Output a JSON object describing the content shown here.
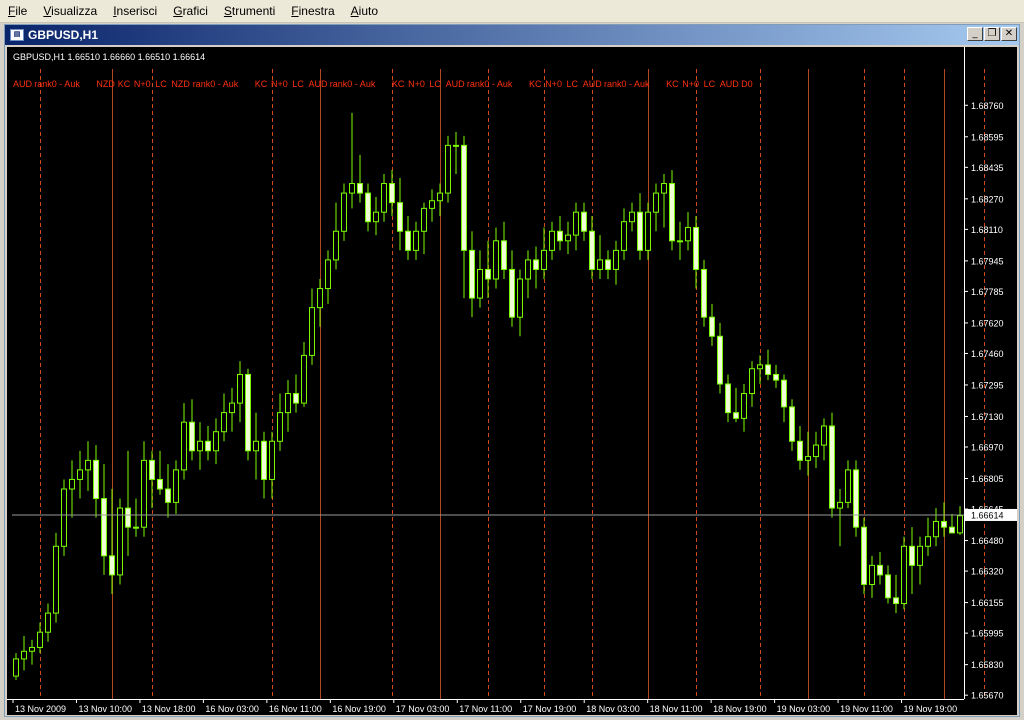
{
  "menu": [
    "File",
    "Visualizza",
    "Inserisci",
    "Grafici",
    "Strumenti",
    "Finestra",
    "Aiuto"
  ],
  "window": {
    "title": "GBPUSD,H1",
    "minimize_glyph": "_",
    "restore_glyph": "❐",
    "close_glyph": "✕"
  },
  "colors": {
    "background": "#000000",
    "bull_body": "#000000",
    "bear_body": "#f0ffd8",
    "candle_outline": "#7cfc00",
    "solid_line": "#b34820",
    "dashed_line": "#d04a20",
    "label_text": "#ff3010",
    "ticks_text": "#ffffff",
    "price_line": "#9a9a9a"
  },
  "chart_data": {
    "type": "candlestick",
    "header": "GBPUSD,H1  1.66510 1.66660 1.66510 1.66614",
    "current_price": 1.66614,
    "current_price_label": "1.66614",
    "ylim": [
      1.6565,
      1.6895
    ],
    "y_ticks": [
      "1.68760",
      "1.68595",
      "1.68435",
      "1.68270",
      "1.68110",
      "1.67945",
      "1.67785",
      "1.67620",
      "1.67460",
      "1.67295",
      "1.67130",
      "1.66970",
      "1.66805",
      "1.66645",
      "1.66480",
      "1.66320",
      "1.66155",
      "1.65995",
      "1.65830",
      "1.65670"
    ],
    "x_ticks": [
      "13 Nov 2009",
      "13 Nov 10:00",
      "13 Nov 18:00",
      "16 Nov 03:00",
      "16 Nov 11:00",
      "16 Nov 19:00",
      "17 Nov 03:00",
      "17 Nov 11:00",
      "17 Nov 19:00",
      "18 Nov 03:00",
      "18 Nov 11:00",
      "18 Nov 19:00",
      "19 Nov 03:00",
      "19 Nov 11:00",
      "19 Nov 19:00"
    ],
    "event_labels": [
      "AUD",
      "rank0 - Auk",
      "NZD",
      "KC",
      "N+0",
      "LC",
      "NZD",
      "rank0 - Auk",
      "KC",
      "N+0",
      "LC",
      "AUD",
      "rank0 - Auk",
      "KC",
      "N+0",
      "LC",
      "AUD",
      "rank0 - Auk",
      "KC",
      "N+0",
      "LC",
      "AUD",
      "rank0 - Auk",
      "KC",
      "N+0",
      "LC",
      "AUD",
      "D0"
    ],
    "event_bars": [
      3,
      12,
      17,
      32,
      38,
      47,
      53,
      59,
      66,
      72,
      79,
      85,
      93,
      99,
      106,
      111,
      116,
      121,
      126,
      132,
      139,
      146
    ],
    "event_styles": [
      "dash",
      "solid",
      "dash",
      "dash",
      "solid",
      "dash",
      "solid",
      "dash",
      "dash",
      "dash",
      "solid",
      "dash",
      "dash",
      "solid",
      "dash",
      "dash",
      "solid",
      "dash",
      "dash",
      "solid",
      "dash",
      "dash"
    ],
    "candles": [
      {
        "o": 1.6577,
        "h": 1.6589,
        "l": 1.6575,
        "c": 1.6586
      },
      {
        "o": 1.6586,
        "h": 1.6598,
        "l": 1.658,
        "c": 1.659
      },
      {
        "o": 1.659,
        "h": 1.6596,
        "l": 1.6583,
        "c": 1.6592
      },
      {
        "o": 1.6592,
        "h": 1.6605,
        "l": 1.6589,
        "c": 1.66
      },
      {
        "o": 1.66,
        "h": 1.6615,
        "l": 1.6595,
        "c": 1.661
      },
      {
        "o": 1.661,
        "h": 1.6652,
        "l": 1.6605,
        "c": 1.6645
      },
      {
        "o": 1.6645,
        "h": 1.668,
        "l": 1.664,
        "c": 1.6675
      },
      {
        "o": 1.6675,
        "h": 1.669,
        "l": 1.666,
        "c": 1.668
      },
      {
        "o": 1.668,
        "h": 1.6695,
        "l": 1.667,
        "c": 1.6685
      },
      {
        "o": 1.6685,
        "h": 1.67,
        "l": 1.6674,
        "c": 1.669
      },
      {
        "o": 1.669,
        "h": 1.6698,
        "l": 1.666,
        "c": 1.667
      },
      {
        "o": 1.667,
        "h": 1.6688,
        "l": 1.663,
        "c": 1.664
      },
      {
        "o": 1.664,
        "h": 1.6675,
        "l": 1.662,
        "c": 1.663
      },
      {
        "o": 1.663,
        "h": 1.667,
        "l": 1.6625,
        "c": 1.6665
      },
      {
        "o": 1.6665,
        "h": 1.6695,
        "l": 1.664,
        "c": 1.6655
      },
      {
        "o": 1.6655,
        "h": 1.667,
        "l": 1.665,
        "c": 1.6655
      },
      {
        "o": 1.6655,
        "h": 1.67,
        "l": 1.665,
        "c": 1.669
      },
      {
        "o": 1.669,
        "h": 1.6695,
        "l": 1.6665,
        "c": 1.668
      },
      {
        "o": 1.668,
        "h": 1.6695,
        "l": 1.6672,
        "c": 1.6675
      },
      {
        "o": 1.6675,
        "h": 1.6688,
        "l": 1.666,
        "c": 1.6668
      },
      {
        "o": 1.6668,
        "h": 1.669,
        "l": 1.6662,
        "c": 1.6685
      },
      {
        "o": 1.6685,
        "h": 1.672,
        "l": 1.668,
        "c": 1.671
      },
      {
        "o": 1.671,
        "h": 1.6722,
        "l": 1.669,
        "c": 1.6695
      },
      {
        "o": 1.6695,
        "h": 1.671,
        "l": 1.6685,
        "c": 1.67
      },
      {
        "o": 1.67,
        "h": 1.6708,
        "l": 1.669,
        "c": 1.6695
      },
      {
        "o": 1.6695,
        "h": 1.6712,
        "l": 1.6688,
        "c": 1.6705
      },
      {
        "o": 1.6705,
        "h": 1.6725,
        "l": 1.67,
        "c": 1.6715
      },
      {
        "o": 1.6715,
        "h": 1.6728,
        "l": 1.6705,
        "c": 1.672
      },
      {
        "o": 1.672,
        "h": 1.6742,
        "l": 1.671,
        "c": 1.6735
      },
      {
        "o": 1.6735,
        "h": 1.6738,
        "l": 1.669,
        "c": 1.6695
      },
      {
        "o": 1.6695,
        "h": 1.6715,
        "l": 1.668,
        "c": 1.67
      },
      {
        "o": 1.67,
        "h": 1.6705,
        "l": 1.667,
        "c": 1.668
      },
      {
        "o": 1.668,
        "h": 1.6705,
        "l": 1.667,
        "c": 1.67
      },
      {
        "o": 1.67,
        "h": 1.6725,
        "l": 1.6695,
        "c": 1.6715
      },
      {
        "o": 1.6715,
        "h": 1.6732,
        "l": 1.6705,
        "c": 1.6725
      },
      {
        "o": 1.6725,
        "h": 1.6735,
        "l": 1.6715,
        "c": 1.672
      },
      {
        "o": 1.672,
        "h": 1.6752,
        "l": 1.6718,
        "c": 1.6745
      },
      {
        "o": 1.6745,
        "h": 1.678,
        "l": 1.674,
        "c": 1.677
      },
      {
        "o": 1.677,
        "h": 1.6785,
        "l": 1.676,
        "c": 1.678
      },
      {
        "o": 1.678,
        "h": 1.68,
        "l": 1.6772,
        "c": 1.6795
      },
      {
        "o": 1.6795,
        "h": 1.6825,
        "l": 1.679,
        "c": 1.681
      },
      {
        "o": 1.681,
        "h": 1.6835,
        "l": 1.6805,
        "c": 1.683
      },
      {
        "o": 1.683,
        "h": 1.6872,
        "l": 1.6822,
        "c": 1.6835
      },
      {
        "o": 1.6835,
        "h": 1.685,
        "l": 1.6825,
        "c": 1.683
      },
      {
        "o": 1.683,
        "h": 1.6835,
        "l": 1.681,
        "c": 1.6815
      },
      {
        "o": 1.6815,
        "h": 1.6828,
        "l": 1.6808,
        "c": 1.682
      },
      {
        "o": 1.682,
        "h": 1.684,
        "l": 1.6815,
        "c": 1.6835
      },
      {
        "o": 1.6835,
        "h": 1.6842,
        "l": 1.6818,
        "c": 1.6825
      },
      {
        "o": 1.6825,
        "h": 1.6838,
        "l": 1.68,
        "c": 1.681
      },
      {
        "o": 1.681,
        "h": 1.6818,
        "l": 1.6795,
        "c": 1.68
      },
      {
        "o": 1.68,
        "h": 1.6815,
        "l": 1.6795,
        "c": 1.681
      },
      {
        "o": 1.681,
        "h": 1.6825,
        "l": 1.6798,
        "c": 1.6822
      },
      {
        "o": 1.6822,
        "h": 1.6832,
        "l": 1.6815,
        "c": 1.6826
      },
      {
        "o": 1.6826,
        "h": 1.6835,
        "l": 1.6818,
        "c": 1.683
      },
      {
        "o": 1.683,
        "h": 1.686,
        "l": 1.6825,
        "c": 1.6855
      },
      {
        "o": 1.6855,
        "h": 1.6862,
        "l": 1.684,
        "c": 1.6855
      },
      {
        "o": 1.6855,
        "h": 1.686,
        "l": 1.6775,
        "c": 1.68
      },
      {
        "o": 1.68,
        "h": 1.681,
        "l": 1.6765,
        "c": 1.6775
      },
      {
        "o": 1.6775,
        "h": 1.68,
        "l": 1.677,
        "c": 1.679
      },
      {
        "o": 1.679,
        "h": 1.6805,
        "l": 1.6775,
        "c": 1.6785
      },
      {
        "o": 1.6785,
        "h": 1.6812,
        "l": 1.678,
        "c": 1.6805
      },
      {
        "o": 1.6805,
        "h": 1.6815,
        "l": 1.6785,
        "c": 1.679
      },
      {
        "o": 1.679,
        "h": 1.68,
        "l": 1.676,
        "c": 1.6765
      },
      {
        "o": 1.6765,
        "h": 1.679,
        "l": 1.6755,
        "c": 1.6785
      },
      {
        "o": 1.6785,
        "h": 1.68,
        "l": 1.6775,
        "c": 1.6795
      },
      {
        "o": 1.6795,
        "h": 1.6802,
        "l": 1.678,
        "c": 1.679
      },
      {
        "o": 1.679,
        "h": 1.6812,
        "l": 1.6785,
        "c": 1.68
      },
      {
        "o": 1.68,
        "h": 1.6815,
        "l": 1.6795,
        "c": 1.681
      },
      {
        "o": 1.681,
        "h": 1.6818,
        "l": 1.68,
        "c": 1.6805
      },
      {
        "o": 1.6805,
        "h": 1.6815,
        "l": 1.6798,
        "c": 1.6808
      },
      {
        "o": 1.6808,
        "h": 1.6825,
        "l": 1.68,
        "c": 1.682
      },
      {
        "o": 1.682,
        "h": 1.6825,
        "l": 1.6805,
        "c": 1.681
      },
      {
        "o": 1.681,
        "h": 1.6818,
        "l": 1.6785,
        "c": 1.679
      },
      {
        "o": 1.679,
        "h": 1.6808,
        "l": 1.6785,
        "c": 1.6795
      },
      {
        "o": 1.6795,
        "h": 1.68,
        "l": 1.6785,
        "c": 1.679
      },
      {
        "o": 1.679,
        "h": 1.6805,
        "l": 1.6782,
        "c": 1.68
      },
      {
        "o": 1.68,
        "h": 1.6822,
        "l": 1.6795,
        "c": 1.6815
      },
      {
        "o": 1.6815,
        "h": 1.6825,
        "l": 1.681,
        "c": 1.682
      },
      {
        "o": 1.682,
        "h": 1.683,
        "l": 1.6795,
        "c": 1.68
      },
      {
        "o": 1.68,
        "h": 1.6825,
        "l": 1.6795,
        "c": 1.682
      },
      {
        "o": 1.682,
        "h": 1.6835,
        "l": 1.681,
        "c": 1.683
      },
      {
        "o": 1.683,
        "h": 1.684,
        "l": 1.6812,
        "c": 1.6835
      },
      {
        "o": 1.6835,
        "h": 1.6842,
        "l": 1.68,
        "c": 1.6805
      },
      {
        "o": 1.6805,
        "h": 1.6815,
        "l": 1.6795,
        "c": 1.6805
      },
      {
        "o": 1.6805,
        "h": 1.682,
        "l": 1.68,
        "c": 1.6812
      },
      {
        "o": 1.6812,
        "h": 1.6818,
        "l": 1.678,
        "c": 1.679
      },
      {
        "o": 1.679,
        "h": 1.6795,
        "l": 1.676,
        "c": 1.6765
      },
      {
        "o": 1.6765,
        "h": 1.6772,
        "l": 1.675,
        "c": 1.6755
      },
      {
        "o": 1.6755,
        "h": 1.6762,
        "l": 1.6725,
        "c": 1.673
      },
      {
        "o": 1.673,
        "h": 1.6735,
        "l": 1.671,
        "c": 1.6715
      },
      {
        "o": 1.6715,
        "h": 1.6728,
        "l": 1.671,
        "c": 1.6712
      },
      {
        "o": 1.6712,
        "h": 1.673,
        "l": 1.6705,
        "c": 1.6725
      },
      {
        "o": 1.6725,
        "h": 1.6742,
        "l": 1.6718,
        "c": 1.6738
      },
      {
        "o": 1.6738,
        "h": 1.6745,
        "l": 1.673,
        "c": 1.674
      },
      {
        "o": 1.674,
        "h": 1.6748,
        "l": 1.6732,
        "c": 1.6735
      },
      {
        "o": 1.6735,
        "h": 1.674,
        "l": 1.6728,
        "c": 1.6732
      },
      {
        "o": 1.6732,
        "h": 1.6735,
        "l": 1.671,
        "c": 1.6718
      },
      {
        "o": 1.6718,
        "h": 1.6722,
        "l": 1.6695,
        "c": 1.67
      },
      {
        "o": 1.67,
        "h": 1.6708,
        "l": 1.6685,
        "c": 1.669
      },
      {
        "o": 1.669,
        "h": 1.6705,
        "l": 1.6682,
        "c": 1.6692
      },
      {
        "o": 1.6692,
        "h": 1.6705,
        "l": 1.6686,
        "c": 1.6698
      },
      {
        "o": 1.6698,
        "h": 1.6712,
        "l": 1.669,
        "c": 1.6708
      },
      {
        "o": 1.6708,
        "h": 1.6715,
        "l": 1.666,
        "c": 1.6665
      },
      {
        "o": 1.6665,
        "h": 1.6675,
        "l": 1.6645,
        "c": 1.6668
      },
      {
        "o": 1.6668,
        "h": 1.669,
        "l": 1.6665,
        "c": 1.6685
      },
      {
        "o": 1.6685,
        "h": 1.669,
        "l": 1.665,
        "c": 1.6655
      },
      {
        "o": 1.6655,
        "h": 1.666,
        "l": 1.662,
        "c": 1.6625
      },
      {
        "o": 1.6625,
        "h": 1.664,
        "l": 1.6618,
        "c": 1.6635
      },
      {
        "o": 1.6635,
        "h": 1.6642,
        "l": 1.6625,
        "c": 1.663
      },
      {
        "o": 1.663,
        "h": 1.6635,
        "l": 1.6615,
        "c": 1.6618
      },
      {
        "o": 1.6618,
        "h": 1.663,
        "l": 1.661,
        "c": 1.6615
      },
      {
        "o": 1.6615,
        "h": 1.665,
        "l": 1.6612,
        "c": 1.6645
      },
      {
        "o": 1.6645,
        "h": 1.6655,
        "l": 1.662,
        "c": 1.6635
      },
      {
        "o": 1.6635,
        "h": 1.665,
        "l": 1.6625,
        "c": 1.6645
      },
      {
        "o": 1.6645,
        "h": 1.666,
        "l": 1.664,
        "c": 1.665
      },
      {
        "o": 1.665,
        "h": 1.6665,
        "l": 1.6645,
        "c": 1.6658
      },
      {
        "o": 1.6658,
        "h": 1.6668,
        "l": 1.665,
        "c": 1.6655
      },
      {
        "o": 1.6655,
        "h": 1.6662,
        "l": 1.6652,
        "c": 1.6652
      },
      {
        "o": 1.6652,
        "h": 1.6666,
        "l": 1.6651,
        "c": 1.6661
      }
    ]
  }
}
